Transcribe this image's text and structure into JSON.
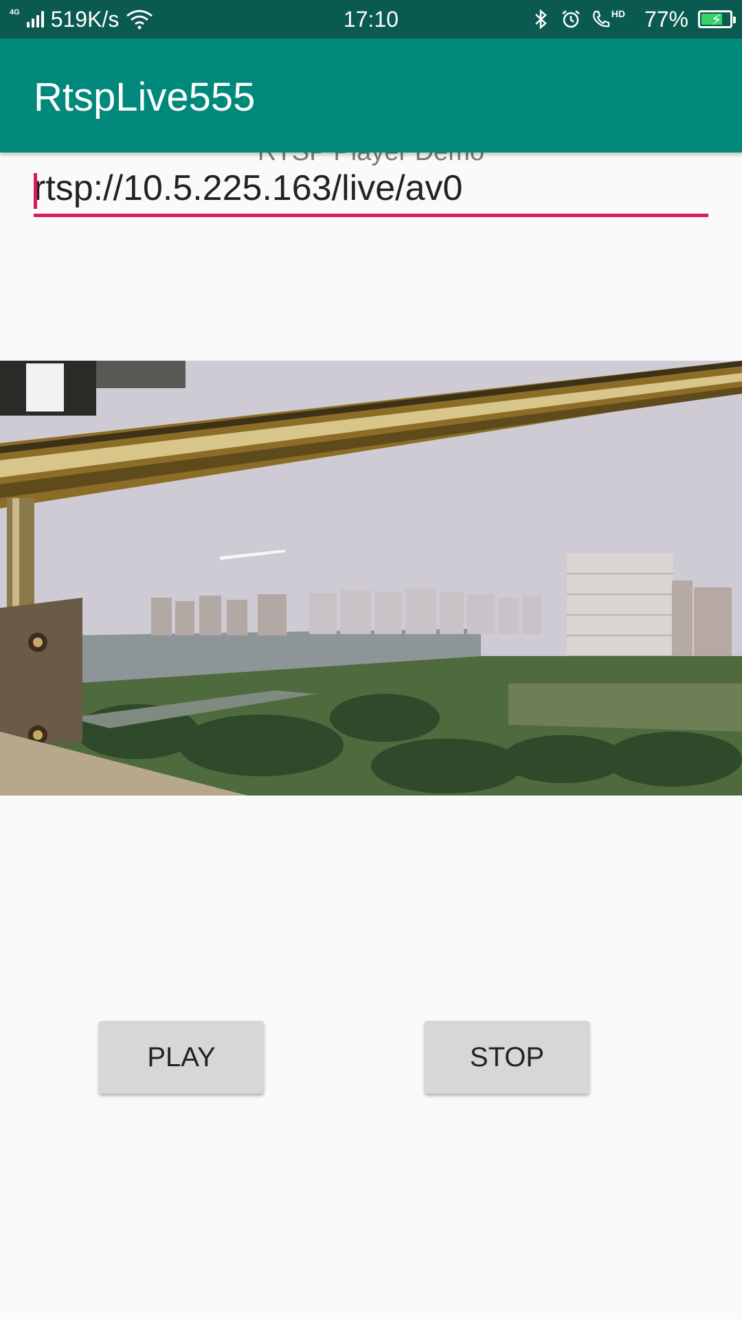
{
  "status_bar": {
    "network": "4G",
    "speed": "519K/s",
    "time": "17:10",
    "hd_label": "HD",
    "battery": "77%",
    "battery_level": 0.77,
    "icons": [
      "signal-icon",
      "wifi-icon",
      "bluetooth-icon",
      "alarm-icon",
      "volte-call-icon",
      "battery-icon"
    ]
  },
  "app_bar": {
    "title": "RtspLive555"
  },
  "main": {
    "subtitle": "RTSP Player Demo",
    "url_value": "rtsp://10.5.225.163/live/av0",
    "play_label": "PLAY",
    "stop_label": "STOP"
  },
  "colors": {
    "status_bar": "#0b5a4f",
    "app_bar": "#00897b",
    "accent": "#d81b60",
    "button": "#d6d7d7"
  }
}
